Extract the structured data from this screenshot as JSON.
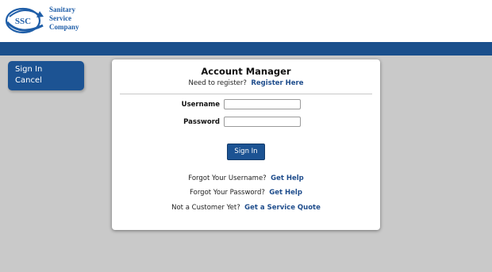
{
  "header": {
    "logo": {
      "initials": "SSC",
      "line1": "Sanitary",
      "line2": "Service",
      "line3": "Company",
      "colors": {
        "blue": "#1f5ea8",
        "band": "#1a4f8c"
      }
    }
  },
  "sidebar": {
    "items": [
      {
        "label": "Sign In"
      },
      {
        "label": "Cancel"
      }
    ]
  },
  "account": {
    "title": "Account Manager",
    "register_prompt": "Need to register?",
    "register_link": "Register Here",
    "username_label": "Username",
    "username_value": "",
    "password_label": "Password",
    "password_value": "",
    "signin_button": "Sign In",
    "forgot_username_text": "Forgot Your Username?",
    "forgot_username_link": "Get Help",
    "forgot_password_text": "Forgot Your Password?",
    "forgot_password_link": "Get Help",
    "not_customer_text": "Not a Customer Yet?",
    "service_quote_link": "Get a Service Quote"
  }
}
